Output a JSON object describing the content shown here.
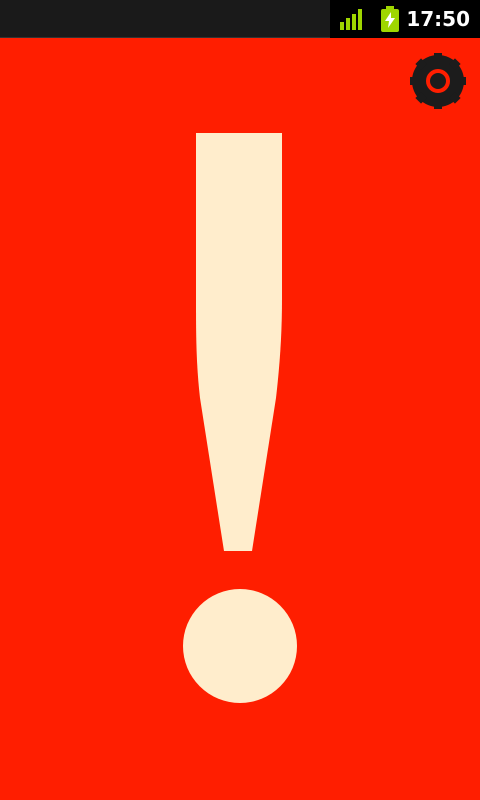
{
  "status_bar": {
    "time": "17:50",
    "signal_icon": "signal-bars-icon",
    "battery_icon": "battery-charging-icon",
    "accent_color": "#9fd600"
  },
  "main": {
    "background_color": "#ff1e00",
    "glyph_color": "#ffedcc",
    "alert_icon": "exclamation-mark-icon",
    "settings_icon": "gear-icon"
  }
}
